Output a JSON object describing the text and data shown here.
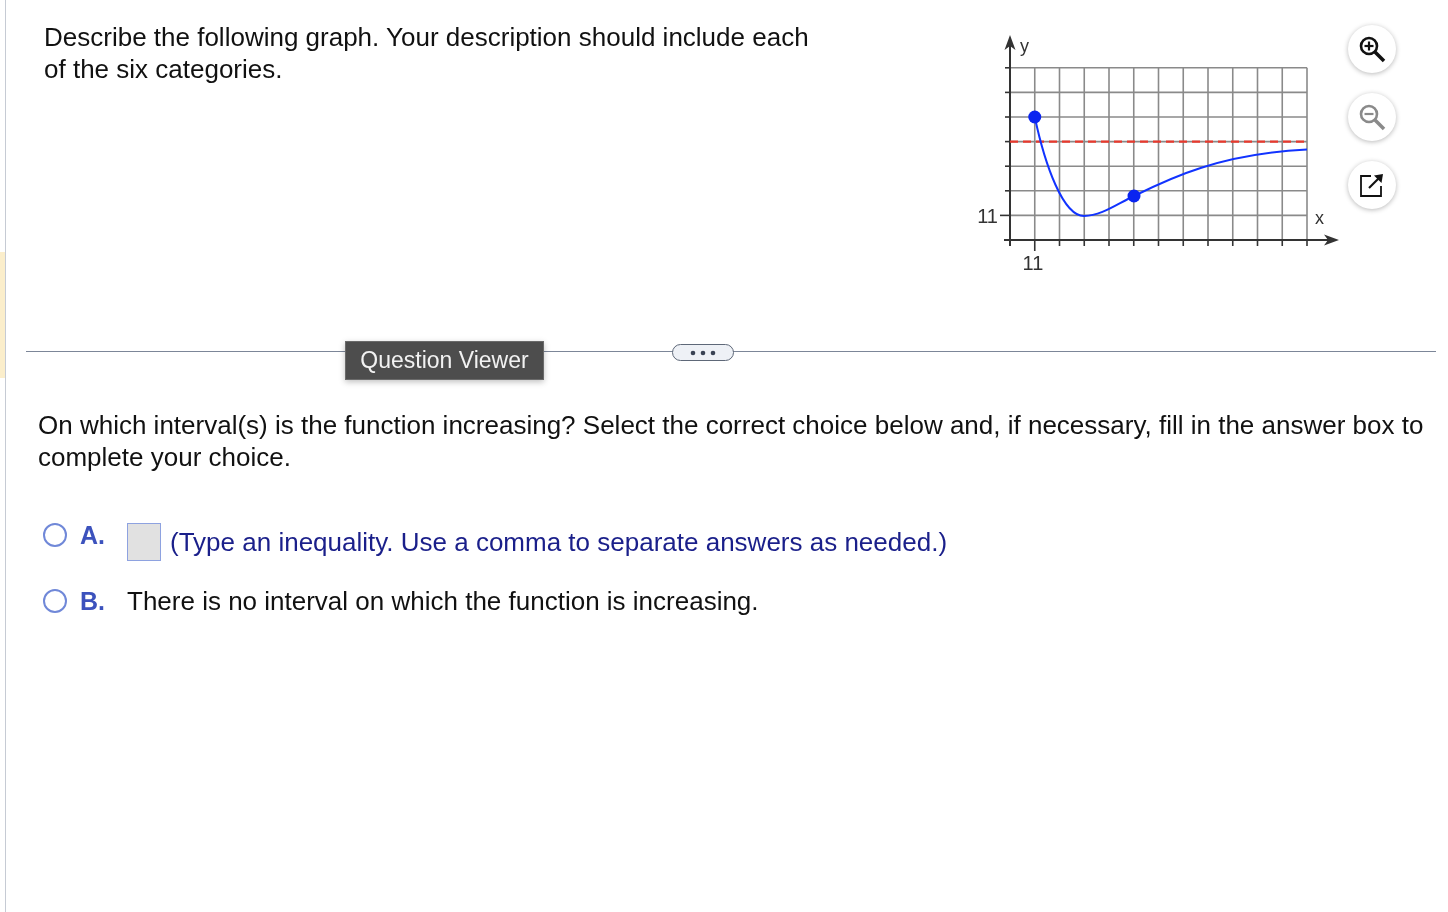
{
  "question": {
    "text": "Describe the following graph. Your description should include each of the six categories."
  },
  "graph": {
    "y_axis_label": "y",
    "x_axis_label": "x",
    "y_tick_label": "11",
    "x_tick_label": "11"
  },
  "graph_tools": [
    {
      "kind": "zoom_in",
      "disabled": false
    },
    {
      "kind": "zoom_out",
      "disabled": true
    },
    {
      "kind": "popout",
      "disabled": false
    }
  ],
  "divider": {
    "tooltip": "Question Viewer"
  },
  "prompt": "On which interval(s) is the function increasing? Select the correct choice below and, if necessary, fill in the answer box to complete your choice.",
  "choices": [
    {
      "kind": "answer_box",
      "letter": "A.",
      "selected": false,
      "hint": "(Type an inequality. Use a comma to separate answers as needed.)"
    },
    {
      "kind": "statement",
      "letter": "B.",
      "selected": false,
      "text": "There is no interval on which the function is increasing."
    }
  ]
}
